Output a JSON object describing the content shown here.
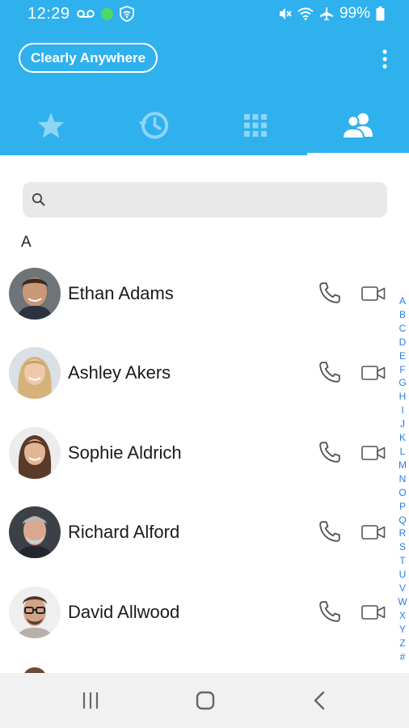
{
  "status_bar": {
    "time": "12:29",
    "battery": "99%",
    "icons": [
      "voicemail-icon",
      "green-dot",
      "shield-wifi-icon",
      "mute-icon",
      "wifi-icon",
      "airplane-icon",
      "battery-icon"
    ]
  },
  "header": {
    "account_label": "Clearly Anywhere",
    "colors": {
      "header_bg": "#2fb1ee",
      "tab_icon": "#8fd5f7",
      "tab_icon_active": "#ffffff"
    }
  },
  "tabs": [
    {
      "id": "favorites",
      "icon": "star-icon",
      "active": false
    },
    {
      "id": "recents",
      "icon": "history-clock-icon",
      "active": false
    },
    {
      "id": "dialpad",
      "icon": "dialpad-grid-icon",
      "active": false
    },
    {
      "id": "contacts",
      "icon": "contacts-people-icon",
      "active": true
    }
  ],
  "search": {
    "placeholder": "",
    "value": ""
  },
  "contacts": {
    "section_letter": "A",
    "items": [
      {
        "name": "Ethan Adams",
        "avatar": "photo",
        "actions": [
          "phone-icon",
          "video-icon"
        ]
      },
      {
        "name": "Ashley Akers",
        "avatar": "photo",
        "actions": [
          "phone-icon",
          "video-icon"
        ]
      },
      {
        "name": "Sophie Aldrich",
        "avatar": "photo",
        "actions": [
          "phone-icon",
          "video-icon"
        ]
      },
      {
        "name": "Richard Alford",
        "avatar": "photo",
        "actions": [
          "phone-icon",
          "video-icon"
        ]
      },
      {
        "name": "David Allwood",
        "avatar": "photo",
        "actions": [
          "phone-icon",
          "video-icon"
        ]
      }
    ]
  },
  "alpha_index": [
    "A",
    "B",
    "C",
    "D",
    "E",
    "F",
    "G",
    "H",
    "I",
    "J",
    "K",
    "L",
    "M",
    "N",
    "O",
    "P",
    "Q",
    "R",
    "S",
    "T",
    "U",
    "V",
    "W",
    "X",
    "Y",
    "Z",
    "#"
  ],
  "nav_bar": {
    "buttons": [
      "recent-apps-icon",
      "home-icon",
      "back-icon"
    ]
  }
}
